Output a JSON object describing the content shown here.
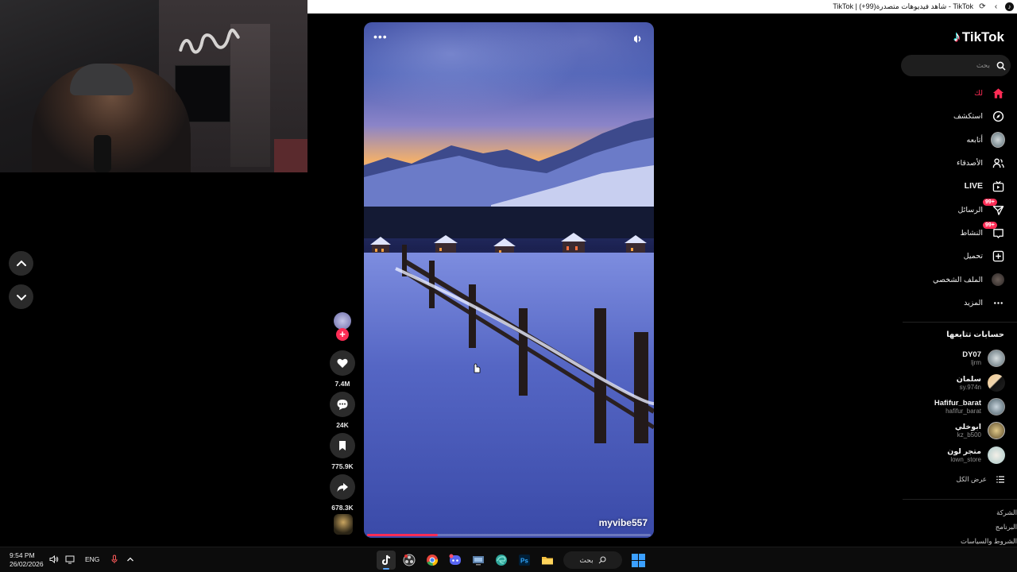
{
  "browser": {
    "title": "TikTok | شاهد فيديوهات متصدرة(99+) - TikTok",
    "icons": [
      "tiktok-logo-icon",
      "refresh-icon",
      "back-icon"
    ]
  },
  "webcam": {
    "neon_text": ""
  },
  "feed_nav": {
    "up_icon": "chevron-up-icon",
    "down_icon": "chevron-down-icon"
  },
  "video": {
    "author": "myvibe557",
    "progress": 0.25,
    "more_icon": "more-horizontal-icon",
    "volume_icon": "volume-icon"
  },
  "actions": {
    "follow_label": "+",
    "likes": "7.4M",
    "comments": "24K",
    "saves": "775.9K",
    "shares": "678.3K"
  },
  "sidebar": {
    "logo": "TikTok",
    "search_placeholder": "بحث",
    "nav": [
      {
        "label": "لك",
        "icon": "home-icon",
        "active": true
      },
      {
        "label": "استكشف",
        "icon": "compass-icon"
      },
      {
        "label": "أتابعه",
        "icon": "following-avatar-icon"
      },
      {
        "label": "الأصدقاء",
        "icon": "friends-icon"
      },
      {
        "label": "LIVE",
        "icon": "live-icon"
      },
      {
        "label": "الرسائل",
        "icon": "messages-icon",
        "badge": "99+"
      },
      {
        "label": "النشاط",
        "icon": "activity-icon",
        "badge": "99+"
      },
      {
        "label": "تحميل",
        "icon": "upload-icon"
      },
      {
        "label": "الملف الشخصي",
        "icon": "profile-avatar-icon"
      },
      {
        "label": "المزيد",
        "icon": "more-icon"
      }
    ],
    "following_title": "حسابات تتابعها",
    "accounts": [
      {
        "name": "DY07",
        "handle": "ljrm"
      },
      {
        "name": "سلمان",
        "handle": "sy.974n"
      },
      {
        "name": "Hafifur_barat",
        "handle": "hafifur_barat"
      },
      {
        "name": "ابوخلي",
        "handle": "kz_b500"
      },
      {
        "name": "متجر لون",
        "handle": "lown_store"
      }
    ],
    "see_all": "عرض الكل",
    "footer": [
      "الشركة",
      "البرنامج",
      "الشروط والسياسات"
    ]
  },
  "taskbar": {
    "time": "9:54 PM",
    "date": "26/02/2026",
    "lang": "ENG",
    "search_label": "بحث",
    "apps": [
      "tiktok-app-icon",
      "obs-app-icon",
      "chrome-app-icon",
      "discord-app-icon",
      "desktop-app-icon",
      "edge-app-icon",
      "photoshop-app-icon",
      "folder-app-icon",
      "windows-start-icon"
    ]
  },
  "colors": {
    "accent": "#fe2c55",
    "background": "#000000",
    "taskbar_accent": "#3ba0ff"
  }
}
